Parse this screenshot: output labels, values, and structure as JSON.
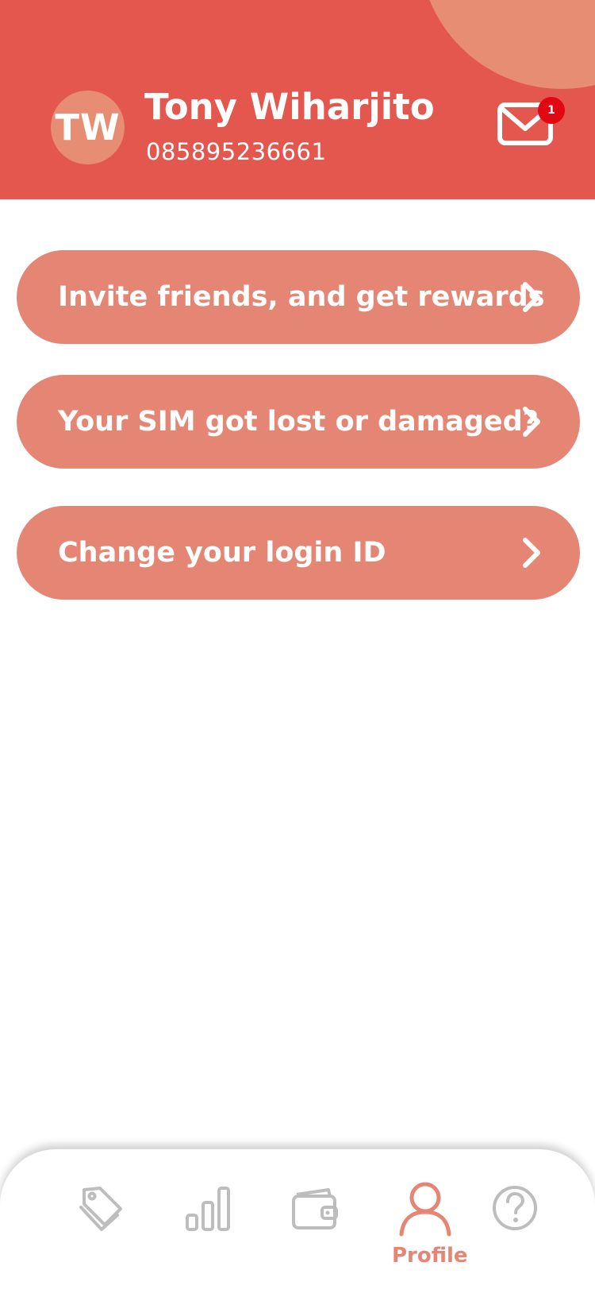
{
  "colors": {
    "header": "#e3574e",
    "header_circle": "#e68d74",
    "menu_item": "#e58674",
    "badge": "#e30613",
    "nav_inactive": "#bdbdbd",
    "nav_active": "#e58674"
  },
  "profile": {
    "initials": "TW",
    "name": "Tony Wiharjito",
    "phone": "085895236661"
  },
  "inbox": {
    "icon": "envelope-icon",
    "unread_count": "1"
  },
  "menu": {
    "items": [
      {
        "label": "Invite friends, and get rewards",
        "icon": "chevron-right-icon"
      },
      {
        "label": "Your SIM got lost or damaged?",
        "icon": "chevron-right-icon"
      },
      {
        "label": "Change your login ID",
        "icon": "chevron-right-icon"
      }
    ]
  },
  "bottom_nav": {
    "items": [
      {
        "icon": "tags-icon",
        "label": ""
      },
      {
        "icon": "bar-chart-icon",
        "label": ""
      },
      {
        "icon": "wallet-icon",
        "label": ""
      },
      {
        "icon": "user-icon",
        "label": "Profile",
        "active": true
      },
      {
        "icon": "help-icon",
        "label": ""
      }
    ]
  }
}
